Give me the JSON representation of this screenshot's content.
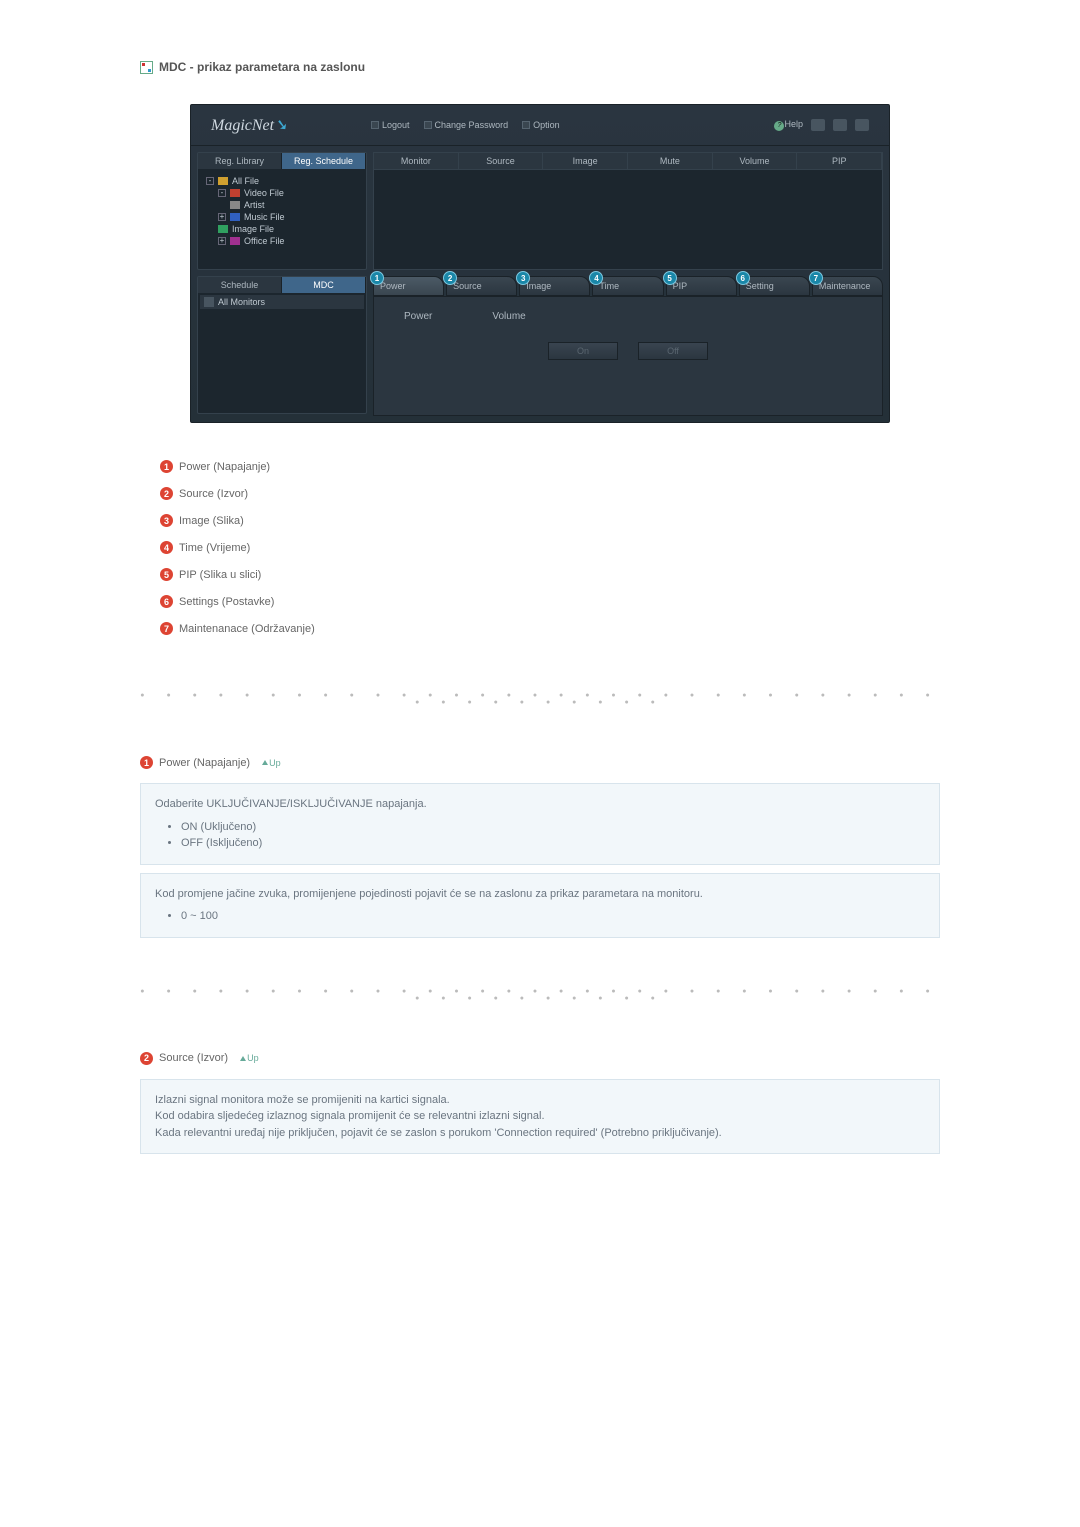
{
  "page": {
    "title": "MDC - prikaz parametara na zaslonu"
  },
  "app": {
    "logo": "MagicNet",
    "header_links": {
      "logout": "Logout",
      "change_password": "Change Password",
      "option": "Option",
      "help": "Help"
    },
    "side_panel_top": {
      "tabs": {
        "library": "Reg. Library",
        "schedule": "Reg. Schedule"
      },
      "tree": {
        "root": "All File",
        "video": "Video File",
        "artist": "Artist",
        "music": "Music File",
        "image": "Image File",
        "office": "Office File"
      }
    },
    "side_panel_bottom": {
      "tabs": {
        "schedule": "Schedule",
        "mdc": "MDC"
      },
      "row": "All Monitors"
    },
    "grid_headers": {
      "monitor": "Monitor",
      "source": "Source",
      "image": "Image",
      "mute": "Mute",
      "volume": "Volume",
      "pip": "PIP"
    },
    "control_tabs": {
      "power": "Power",
      "source": "Source",
      "image": "Image",
      "time": "Time",
      "pip": "PIP",
      "setting": "Setting",
      "maintenance": "Maintenance"
    },
    "control_panel": {
      "label_power": "Power",
      "label_volume": "Volume",
      "btn_on": "On",
      "btn_off": "Off"
    }
  },
  "legend": [
    {
      "num": "1",
      "label": "Power (Napajanje)"
    },
    {
      "num": "2",
      "label": "Source (Izvor)"
    },
    {
      "num": "3",
      "label": "Image (Slika)"
    },
    {
      "num": "4",
      "label": "Time (Vrijeme)"
    },
    {
      "num": "5",
      "label": "PIP (Slika u slici)"
    },
    {
      "num": "6",
      "label": "Settings (Postavke)"
    },
    {
      "num": "7",
      "label": "Maintenanace (Održavanje)"
    }
  ],
  "sections": {
    "power": {
      "num": "1",
      "title": "Power (Napajanje)",
      "up": "Up",
      "box1_intro": "Odaberite UKLJUČIVANJE/ISKLJUČIVANJE napajanja.",
      "box1_items": [
        "ON (Uključeno)",
        "OFF (Isključeno)"
      ],
      "box2_text": "Kod promjene jačine zvuka, promijenjene pojedinosti pojavit će se na zaslonu za prikaz parametara na monitoru.",
      "box2_items": [
        "0 ~ 100"
      ]
    },
    "source": {
      "num": "2",
      "title": "Source (Izvor)",
      "up": "Up",
      "box_lines": [
        "Izlazni signal monitora može se promijeniti na kartici signala.",
        "Kod odabira sljedećeg izlaznog signala promijenit će se relevantni izlazni signal.",
        "Kada relevantni uređaj nije priključen, pojavit će se zaslon s porukom 'Connection required' (Potrebno priključivanje)."
      ]
    }
  }
}
